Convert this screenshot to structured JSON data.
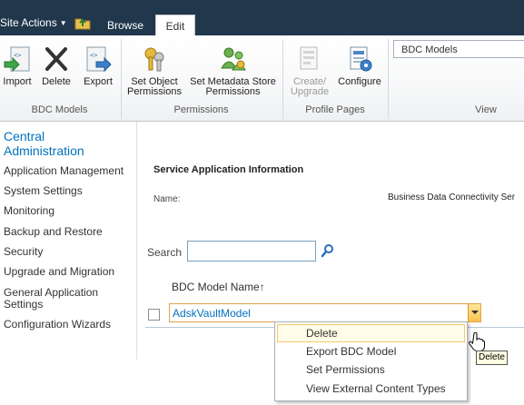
{
  "topbar": {
    "site_actions": "Site Actions",
    "tabs": [
      {
        "label": "Browse",
        "active": false
      },
      {
        "label": "Edit",
        "active": true
      }
    ]
  },
  "ribbon": {
    "groups": [
      {
        "label": "BDC Models",
        "buttons": [
          {
            "label": "Import",
            "icon": "import-icon"
          },
          {
            "label": "Delete",
            "icon": "delete-x-icon"
          },
          {
            "label": "Export",
            "icon": "export-icon"
          }
        ]
      },
      {
        "label": "Permissions",
        "buttons": [
          {
            "label": "Set Object\nPermissions",
            "icon": "keys-icon"
          },
          {
            "label": "Set Metadata Store\nPermissions",
            "icon": "people-icon"
          }
        ]
      },
      {
        "label": "Profile Pages",
        "buttons": [
          {
            "label": "Create/\nUpgrade",
            "icon": "create-page-icon",
            "disabled": true
          },
          {
            "label": "Configure",
            "icon": "configure-icon"
          }
        ]
      },
      {
        "label": "View",
        "select_value": "BDC Models"
      }
    ]
  },
  "leftnav": {
    "title": "Central\nAdministration",
    "items": [
      "Application Management",
      "System Settings",
      "Monitoring",
      "Backup and Restore",
      "Security",
      "Upgrade and Migration",
      "General Application\nSettings",
      "Configuration Wizards"
    ]
  },
  "main": {
    "heading": "Service Application Information",
    "name_label": "Name:",
    "name_value": "Business Data Connectivity Ser",
    "search_label": "Search",
    "search_value": "",
    "column_header": "BDC Model Name",
    "sort_indicator": "↑",
    "rows": [
      {
        "name": "AdskVaultModel"
      }
    ]
  },
  "context_menu": {
    "items": [
      "Delete",
      "Export BDC Model",
      "Set Permissions",
      "View External Content Types"
    ],
    "hovered": "Delete"
  },
  "tooltip": "Delete",
  "colors": {
    "topbar": "#21374c",
    "link": "#0072bc",
    "highlight_border": "#e0a54a"
  }
}
